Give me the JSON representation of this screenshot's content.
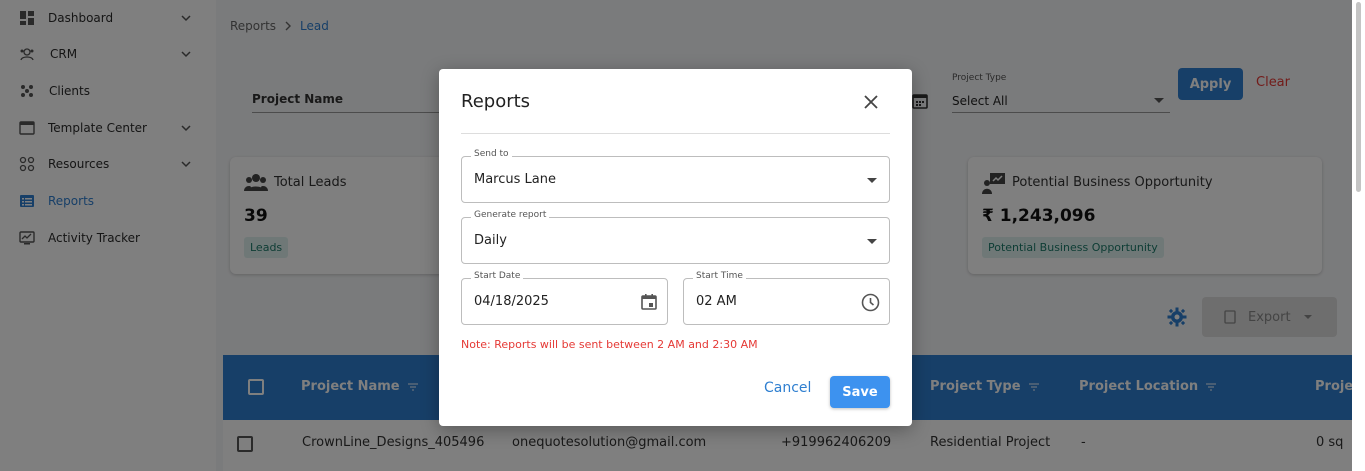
{
  "sidebar": {
    "items": [
      {
        "label": "Dashboard",
        "icon": "dashboard-icon",
        "chevron": true
      },
      {
        "label": "CRM",
        "icon": "crm-icon",
        "chevron": true
      },
      {
        "label": "Clients",
        "icon": "clients-icon",
        "chevron": false
      },
      {
        "label": "Template Center",
        "icon": "template-icon",
        "chevron": true
      },
      {
        "label": "Resources",
        "icon": "resources-icon",
        "chevron": true
      },
      {
        "label": "Reports",
        "icon": "reports-icon",
        "chevron": false,
        "active": true
      },
      {
        "label": "Activity Tracker",
        "icon": "activity-icon",
        "chevron": false
      }
    ]
  },
  "breadcrumb": {
    "parent": "Reports",
    "current": "Lead"
  },
  "filters": {
    "project_name_label": "Project Name",
    "project_type_label": "Project Type",
    "project_type_value": "Select All",
    "apply_label": "Apply",
    "clear_label": "Clear"
  },
  "cards": [
    {
      "title": "Total Leads",
      "value": "39",
      "badge": "Leads"
    },
    {
      "title": "Potential Business Opportunity",
      "value": "₹ 1,243,096",
      "badge": "Potential Business Opportunity"
    }
  ],
  "toolbar": {
    "export_label": "Export"
  },
  "table": {
    "headers": [
      "Project Name",
      "Project Type",
      "Project Location",
      "Proje"
    ],
    "row": {
      "project_name": "CrownLine_Designs_405496",
      "email": "onequotesolution@gmail.com",
      "phone": "+919962406209",
      "project_type": "Residential Project",
      "project_location": "-",
      "area": "0 sq"
    }
  },
  "modal": {
    "title": "Reports",
    "send_to_label": "Send to",
    "send_to_value": "Marcus Lane",
    "generate_label": "Generate report",
    "generate_value": "Daily",
    "start_date_label": "Start Date",
    "start_date_value": "04/18/2025",
    "start_time_label": "Start Time",
    "start_time_value": "02 AM",
    "note": "Note: Reports will be sent between 2 AM and 2:30 AM",
    "cancel_label": "Cancel",
    "save_label": "Save"
  },
  "colors": {
    "accent": "#2f7fd0",
    "danger": "#e53935",
    "badge_bg": "#dff1ee",
    "badge_text": "#1d7a6a"
  }
}
